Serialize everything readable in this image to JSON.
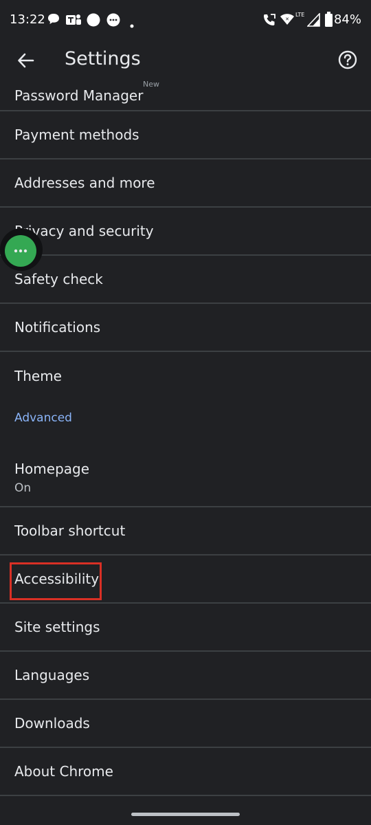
{
  "status_bar": {
    "time": "13:22",
    "network_label": "LTE",
    "battery": "84%",
    "icons": [
      "chat-bubble-icon",
      "teams-icon",
      "circle-notification-icon",
      "messages-icon",
      "dot-icon",
      "wifi-calling-icon",
      "wifi-icon",
      "signal-icon",
      "battery-icon"
    ]
  },
  "toolbar": {
    "title": "Settings",
    "back_icon": "arrow-back-icon",
    "help_icon": "help-icon"
  },
  "settings": {
    "partial_item": "Password Manager",
    "partial_badge": "New",
    "items_group1": [
      "Payment methods",
      "Addresses and more",
      "Privacy and security",
      "Safety check",
      "Notifications",
      "Theme"
    ],
    "advanced_header": "Advanced",
    "homepage": {
      "label": "Homepage",
      "subtitle": "On"
    },
    "items_group2": [
      "Toolbar shortcut",
      "Accessibility",
      "Site settings",
      "Languages",
      "Downloads",
      "About Chrome"
    ]
  },
  "highlight_color": "#d93025",
  "bubble_color": "#34a853",
  "accent_color": "#8ab4f8"
}
